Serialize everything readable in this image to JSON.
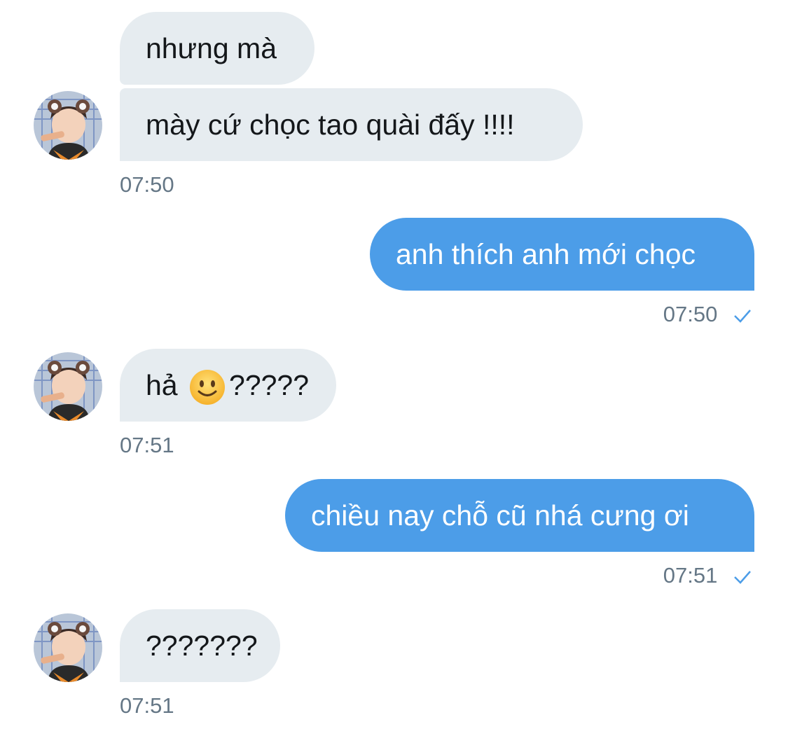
{
  "messages": [
    {
      "direction": "received",
      "text": "nhưng mà"
    },
    {
      "direction": "received",
      "text": "mày cứ chọc tao quài đấy !!!!"
    },
    {
      "direction": "received",
      "time": "07:50"
    },
    {
      "direction": "sent",
      "text": "anh thích anh mới chọc",
      "time": "07:50"
    },
    {
      "direction": "received",
      "text_before": "hả",
      "emoji": "slightly-smiling-face-icon",
      "text_after": "?????",
      "time": "07:51"
    },
    {
      "direction": "sent",
      "text": "chiều nay chỗ cũ nhá cưng ơi",
      "time": "07:51"
    },
    {
      "direction": "received",
      "text": "???????",
      "time": "07:51"
    }
  ],
  "colors": {
    "sent_bubble": "#4c9de8",
    "received_bubble": "#e6ecf0",
    "timestamp": "#657786",
    "check": "#4c9de8"
  }
}
